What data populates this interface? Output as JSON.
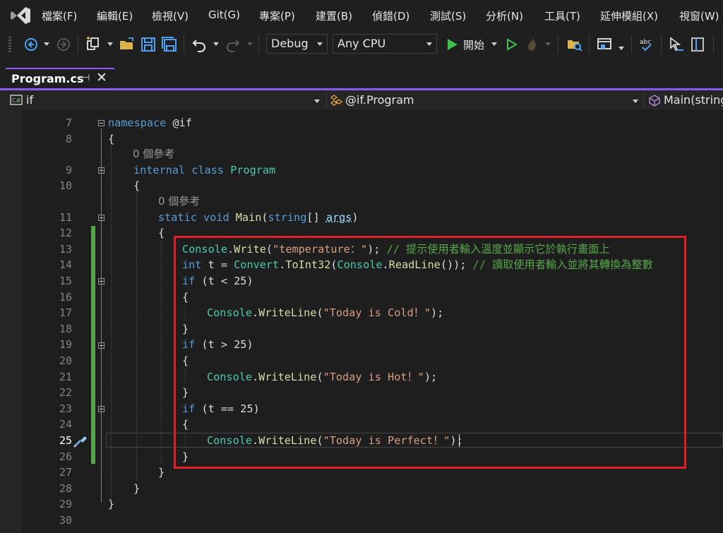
{
  "menu": {
    "items": [
      "檔案(F)",
      "編輯(E)",
      "檢視(V)",
      "Git(G)",
      "專案(P)",
      "建置(B)",
      "偵錯(D)",
      "測試(S)",
      "分析(N)",
      "工具(T)",
      "延伸模組(X)",
      "視窗(W)"
    ]
  },
  "toolbar": {
    "config": "Debug",
    "platform": "Any CPU",
    "start_label": "開始"
  },
  "tab": {
    "title": "Program.cs",
    "pin": "⊣",
    "close": "✕"
  },
  "navbar": {
    "project": "if",
    "type": "@if.Program",
    "member": "Main(string"
  },
  "editor": {
    "line_numbers": [
      "7",
      "8",
      "9",
      "10",
      "11",
      "12",
      "13",
      "14",
      "15",
      "16",
      "17",
      "18",
      "19",
      "20",
      "21",
      "22",
      "23",
      "24",
      "25",
      "26",
      "27",
      "28",
      "29",
      "30"
    ],
    "ref_count": "0 個參考",
    "code": {
      "namespace_kw": "namespace",
      "namespace_name": " @if",
      "open_brace": "{",
      "close_brace": "}",
      "internal_kw": "internal",
      "class_kw": "class",
      "class_name": "Program",
      "static_kw": "static",
      "void_kw": "void",
      "main": "Main",
      "paren_open": "(",
      "string_kw": "string",
      "args_bracket": "[] ",
      "args": "args",
      "paren_close": ")",
      "console": "Console",
      "dot": ".",
      "write": "Write",
      "write_line": "WriteLine",
      "str_temp": "\"temperature：\"",
      "close_semi": ");",
      "comment1": "// 提示使用者輸入溫度並顯示它於執行畫面上",
      "int_kw": "int",
      "t_assign": " t = ",
      "convert": "Convert",
      "toint": "ToInt32",
      "readline": "ReadLine",
      "close_semi2": "()); ",
      "comment2": "// 讀取使用者輸入並將其轉換為整數",
      "if_kw": "if",
      "cond1": " (t < 25)",
      "cond2": " (t > 25)",
      "cond3": " (t == 25)",
      "str_cold": "\"Today is Cold！\"",
      "str_hot": "\"Today is Hot！\"",
      "str_perfect": "\"Today is Perfect！\""
    }
  }
}
